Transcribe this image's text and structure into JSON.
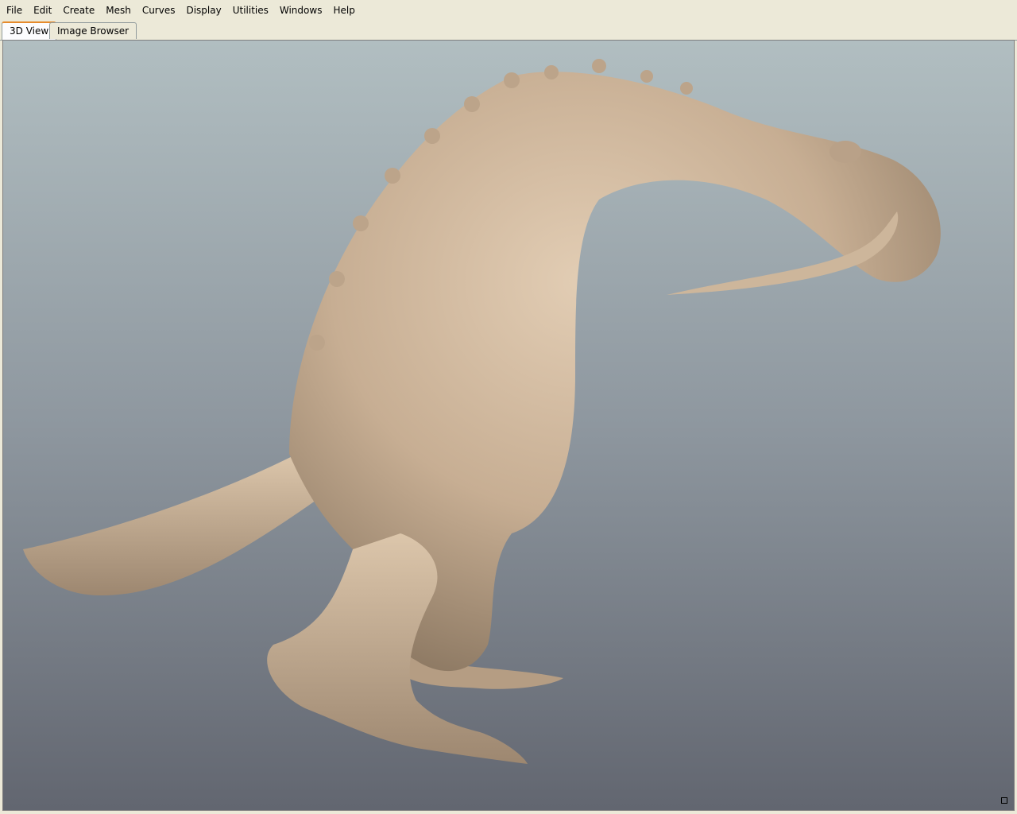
{
  "menubar": {
    "items": [
      {
        "label": "File"
      },
      {
        "label": "Edit"
      },
      {
        "label": "Create"
      },
      {
        "label": "Mesh"
      },
      {
        "label": "Curves"
      },
      {
        "label": "Display"
      },
      {
        "label": "Utilities"
      },
      {
        "label": "Windows"
      },
      {
        "label": "Help"
      }
    ]
  },
  "tabs": [
    {
      "label": "3D View",
      "active": true
    },
    {
      "label": "Image Browser",
      "active": false
    }
  ],
  "viewport": {
    "content": "sculpted-creature-model",
    "background_top": "#b1bec1",
    "background_bottom": "#626670",
    "model_color": "#c9b39a"
  }
}
